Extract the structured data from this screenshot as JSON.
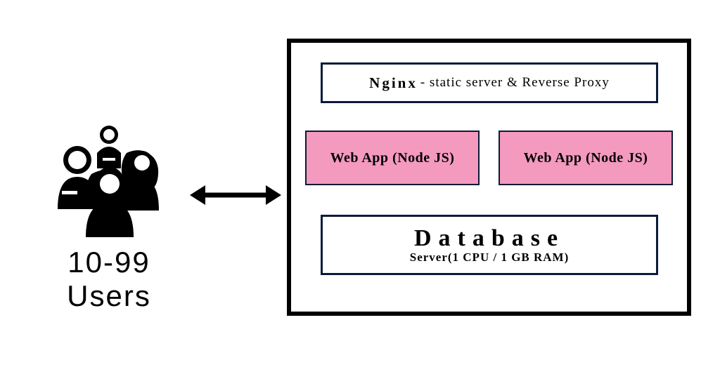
{
  "users": {
    "label_line1": "10-99",
    "label_line2": "Users",
    "icon_name": "users-group-icon"
  },
  "arrow": {
    "name": "bidirectional-arrow-icon"
  },
  "server": {
    "nginx": {
      "strong": "Nginx",
      "rest": "- static server & Reverse Proxy"
    },
    "webapps": [
      {
        "label": "Web App (Node JS)"
      },
      {
        "label": "Web App (Node JS)"
      }
    ],
    "database": {
      "title": "Database",
      "subtitle": "Server(1 CPU / 1 GB RAM)"
    }
  },
  "colors": {
    "accent_pink": "#f49abf",
    "border_navy": "#0b1a3a"
  }
}
